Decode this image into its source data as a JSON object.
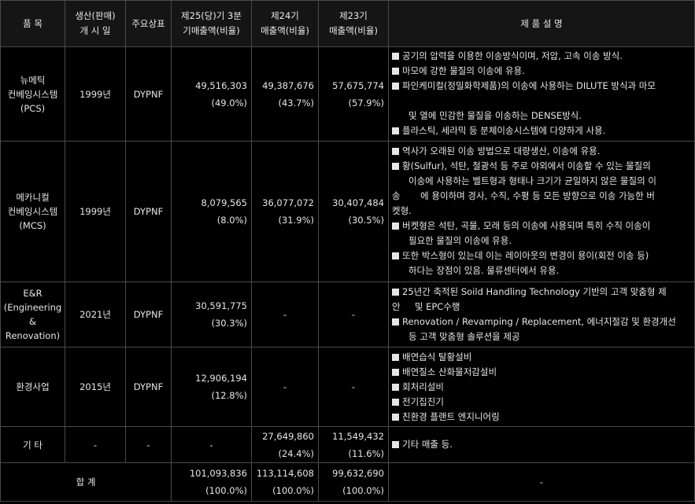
{
  "header": {
    "item": "품 목",
    "launch_1": "생산(판매)",
    "launch_2": "개 시 일",
    "brand": "주요상표",
    "q25_1": "제25(당)기 3분",
    "q25_2": "기매출액(비율)",
    "q24_1": "제24기",
    "q24_2": "매출액(비율)",
    "q23_1": "제23기",
    "q23_2": "매출액(비율)",
    "desc": "제 품 설 명"
  },
  "rows": [
    {
      "name": [
        "뉴메틱",
        "컨베잉시스템",
        "(PCS)"
      ],
      "launch": "1999년",
      "brand": "DYPNF",
      "q25": "49,516,303",
      "q25_pct": "(49.0%)",
      "q24": "49,387,676",
      "q24_pct": "(43.7%)",
      "q23": "57,675,774",
      "q23_pct": "(57.9%)",
      "desc": [
        "공기의 압력을 이용한 이송방식이며, 저압, 고속 이송 방식.",
        "마모에 강한 물질의 이송에 유용.",
        "파인케미컬(정밀화학제품)의 이송에 사용하는 DILUTE 방식과 마모",
        "",
        "및 열에 민감한 물질을 이송하는 DENSE방식.",
        "플라스틱, 세라믹 등 분체이송시스템에 다양하게 사용."
      ]
    },
    {
      "name": [
        "메카니컬",
        "컨베잉시스템",
        "(MCS)"
      ],
      "launch": "1999년",
      "brand": "DYPNF",
      "q25": "8,079,565",
      "q25_pct": "(8.0%)",
      "q24": "36,077,072",
      "q24_pct": "(31.9%)",
      "q23": "30,407,484",
      "q23_pct": "(30.5%)",
      "desc": [
        "역사가 오래된 이송 방법으로 대량생산, 이송에 유용.",
        "황(Sulfur), 석탄, 철광석 등 주로 야외에서 이송할 수 있는 물질의",
        "이송에 사용하는 벨트형과 형태나 크기가 균일하지 않은 물질의 이",
        "송       에 용이하며 경사, 수직, 수평 등 모든 방향으로 이송 가능한 버",
        "켓형.",
        "버켓형은 석탄, 곡물, 모래 등의 이송에 사용되며 특히 수직 이송이",
        "필요한 물질의 이송에 유용.",
        "또한 박스형이 있는데 이는 레이아웃의 변경이 용이(회전 이송 등)",
        "하다는 장점이 있음. 물류센터에서 유용."
      ]
    },
    {
      "name": [
        "E&R",
        "(Engineering",
        "& Renovation)"
      ],
      "launch": "2021년",
      "brand": "DYPNF",
      "q25": "30,591,775",
      "q25_pct": "(30.3%)",
      "q24": "-",
      "q23": "-",
      "desc": [
        "25년간 축적된 Soild Handling Technology 기반의 고객 맞춤형 제",
        "안     및 EPC수행",
        "Renovation / Revamping / Replacement, 에너지절감 및 환경개선",
        "등 고객 맞춤형 솔루션을 제공"
      ]
    },
    {
      "name": [
        "환경사업"
      ],
      "launch": "2015년",
      "brand": "DYPNF",
      "q25": "12,906,194",
      "q25_pct": "(12.8%)",
      "q24": "-",
      "q23": "-",
      "desc": [
        "배연습식 탈황설비",
        "배연질소 산화물저감설비",
        "회처리설비",
        "전기집진기",
        "친환경 플랜트 엔지니어링"
      ]
    },
    {
      "name": [
        "기 타"
      ],
      "launch": "-",
      "brand": "-",
      "q25": "-",
      "q24": "27,649,860",
      "q24_pct": "(24.4%)",
      "q23": "11,549,432",
      "q23_pct": "(11.6%)",
      "desc": [
        "기타 매출 등."
      ]
    }
  ],
  "total": {
    "label": "합 계",
    "q25": "101,093,836",
    "q25_pct": "(100.0%)",
    "q24": "113,114,608",
    "q24_pct": "(100.0%)",
    "q23": "99,632,690",
    "q23_pct": "(100.0%)",
    "desc": "-"
  }
}
